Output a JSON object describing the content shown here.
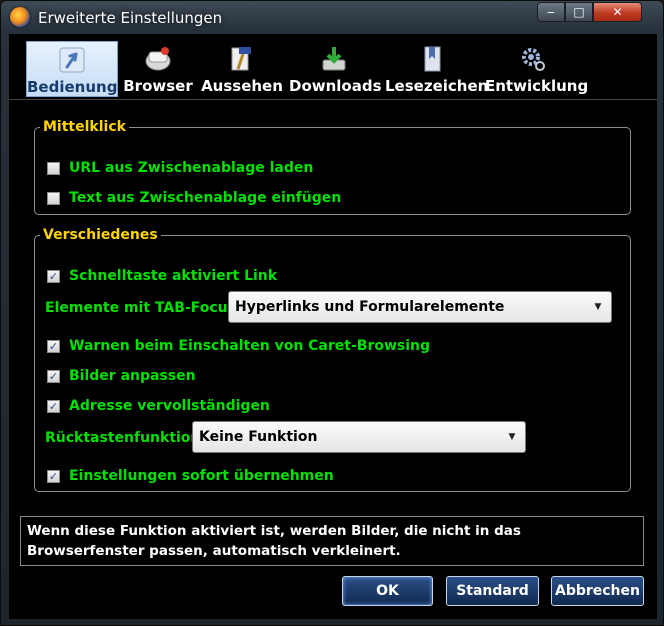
{
  "window": {
    "title": "Erweiterte Einstellungen",
    "controls": {
      "minimize": "‒",
      "maximize": "□",
      "close": "✕"
    }
  },
  "tabs": [
    {
      "label": "Bedienung",
      "icon": "pointer-icon",
      "active": true
    },
    {
      "label": "Browser",
      "icon": "browser-icon",
      "active": false
    },
    {
      "label": "Aussehen",
      "icon": "paintbrush-icon",
      "active": false
    },
    {
      "label": "Downloads",
      "icon": "download-icon",
      "active": false
    },
    {
      "label": "Lesezeichen",
      "icon": "bookmark-icon",
      "active": false
    },
    {
      "label": "Entwicklung",
      "icon": "gears-icon",
      "active": false
    }
  ],
  "mittelklick": {
    "legend": "Mittelklick",
    "options": [
      {
        "label": "URL aus Zwischenablage laden",
        "checked": false
      },
      {
        "label": "Text aus Zwischenablage einfügen",
        "checked": false
      }
    ]
  },
  "verschiedenes": {
    "legend": "Verschiedenes",
    "schnelltaste": {
      "label": "Schnelltaste aktiviert Link",
      "checked": true
    },
    "tabfocus": {
      "label": "Elemente mit TAB-Focus",
      "value": "Hyperlinks und Formularelemente"
    },
    "caret": {
      "label": "Warnen beim Einschalten von Caret-Browsing",
      "checked": true
    },
    "bilder": {
      "label": "Bilder anpassen",
      "checked": true
    },
    "adresse": {
      "label": "Adresse vervollständigen",
      "checked": true
    },
    "ruecktaste": {
      "label": "Rücktastenfunktion",
      "value": "Keine Funktion"
    },
    "sofort": {
      "label": "Einstellungen sofort übernehmen",
      "checked": true
    }
  },
  "description": "Wenn diese Funktion aktiviert ist, werden Bilder, die nicht in das Browserfenster passen, automatisch verkleinert.",
  "buttons": {
    "ok": "OK",
    "standard": "Standard",
    "cancel": "Abbrechen"
  },
  "colors": {
    "legend": "#ffd400",
    "option_text": "#00e000",
    "active_tab": "#163a6b",
    "button": "#1d3d6e"
  }
}
